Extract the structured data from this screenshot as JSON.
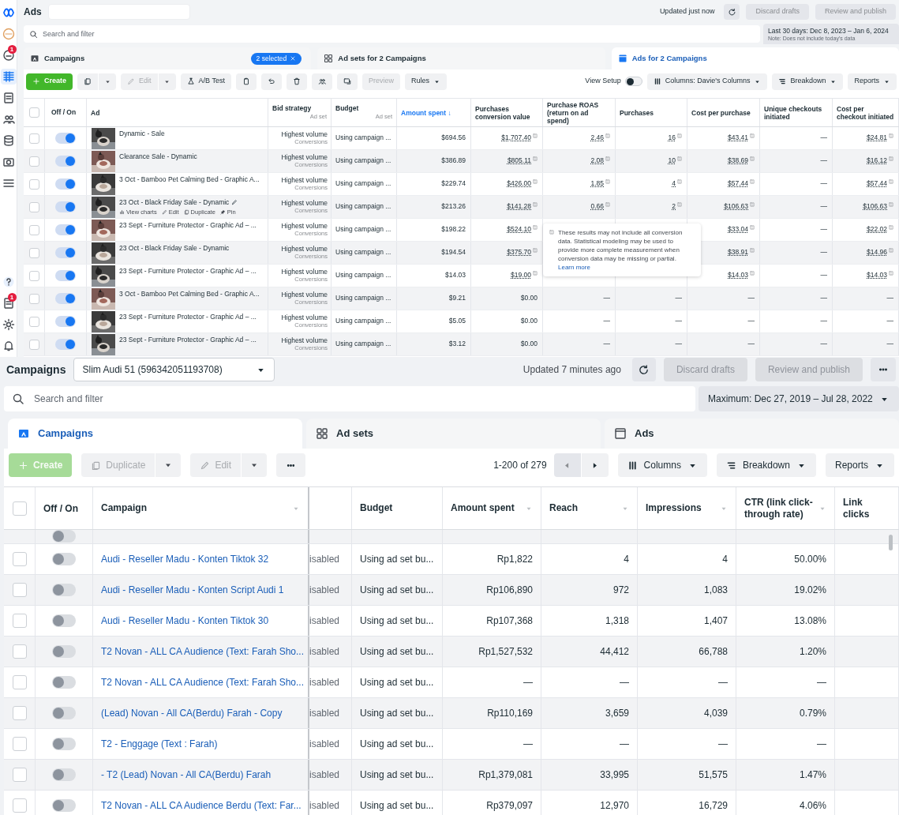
{
  "top": {
    "rail": {
      "top": [
        {
          "kind": "logo",
          "selected": false
        },
        {
          "kind": "avatar",
          "selected": false
        },
        {
          "kind": "alert",
          "selected": false,
          "badge": "1"
        },
        {
          "kind": "grid",
          "selected": true
        },
        {
          "kind": "doc",
          "selected": false
        },
        {
          "kind": "people",
          "selected": false
        },
        {
          "kind": "stack",
          "selected": false
        },
        {
          "kind": "camera",
          "selected": false
        },
        {
          "kind": "menu",
          "selected": false
        }
      ],
      "bottom": [
        {
          "kind": "help",
          "selected": false
        },
        {
          "kind": "doc",
          "selected": false,
          "badge": "1"
        },
        {
          "kind": "gear",
          "selected": false
        },
        {
          "kind": "bell",
          "selected": false
        }
      ]
    },
    "title": "Ads",
    "updated": "Updated just now",
    "actions": [
      {
        "label": "Discard drafts",
        "disabled": true
      },
      {
        "label": "Review and publish",
        "disabled": true
      }
    ],
    "search": {
      "placeholder": "Search and filter"
    },
    "date_range": {
      "label": "Last 30 days: Dec 8, 2023 – Jan 6, 2024",
      "note": "Note: Does not include today's data"
    },
    "tabs": [
      {
        "kind": "campaigns",
        "label": "Campaigns",
        "selected": false,
        "chip": "2 selected"
      },
      {
        "kind": "adsets",
        "label": "Ad sets for 2 Campaigns",
        "selected": false
      },
      {
        "kind": "ads",
        "label": "Ads for 2 Campaigns",
        "selected": true
      }
    ],
    "toolbar": [
      {
        "kind": "create",
        "label": "Create",
        "disabled": false
      },
      {
        "kind": "duplicate",
        "disabled": false
      },
      {
        "kind": "edit",
        "label": "Edit",
        "disabled": true
      },
      {
        "kind": "abtest",
        "label": "A/B Test",
        "disabled": false
      },
      {
        "kind": "clipboard",
        "disabled": false
      },
      {
        "kind": "undo",
        "disabled": false
      },
      {
        "kind": "delete",
        "disabled": false
      },
      {
        "kind": "audience",
        "disabled": false
      },
      {
        "kind": "export",
        "disabled": false
      },
      {
        "kind": "preview",
        "label": "Preview",
        "disabled": true
      },
      {
        "kind": "rules",
        "label": "Rules",
        "disabled": false
      }
    ],
    "view_setup": {
      "label": "View Setup",
      "on": false
    },
    "menus": [
      "Columns: Davie's Columns",
      "Breakdown",
      "Reports"
    ],
    "table": {
      "header_checked": false,
      "toggle_column": "Off / On",
      "columns": [
        {
          "kind": "ad",
          "label": "Ad",
          "sorted": false
        },
        {
          "kind": "bid",
          "label": "Bid strategy",
          "sub": "Ad set",
          "sorted": false
        },
        {
          "kind": "text",
          "label": "Budget",
          "sub": "Ad set",
          "sorted": false
        },
        {
          "kind": "metric",
          "label": "Amount spent ↓",
          "sorted": true
        },
        {
          "kind": "metric",
          "label": "Purchases conversion value",
          "sorted": false
        },
        {
          "kind": "metric",
          "label": "Purchase ROAS (return on ad spend)",
          "sorted": false
        },
        {
          "kind": "metric",
          "label": "Purchases",
          "sorted": false
        },
        {
          "kind": "metric",
          "label": "Cost per purchase",
          "sorted": false
        },
        {
          "kind": "metric",
          "label": "Unique checkouts initiated",
          "sorted": false
        },
        {
          "kind": "metric",
          "label": "Cost per checkout initiated",
          "sorted": false
        }
      ],
      "rows": [
        {
          "checked": false,
          "on": true,
          "cells": [
            {
              "text": "Dynamic - Sale"
            },
            {
              "text": "Highest volume",
              "sub": "Conversions"
            },
            "Using campaign ...",
            "$694.56",
            {
              "text": "$1,707.40",
              "modeled": true
            },
            {
              "text": "2.46",
              "modeled": true
            },
            {
              "text": "16",
              "modeled": true
            },
            {
              "text": "$43.41",
              "modeled": true
            },
            "—",
            {
              "text": "$24.81",
              "modeled": true
            }
          ]
        },
        {
          "checked": false,
          "on": true,
          "cells": [
            {
              "text": "Clearance Sale - Dynamic"
            },
            {
              "text": "Highest volume",
              "sub": "Conversions"
            },
            "Using campaign ...",
            "$386.89",
            {
              "text": "$805.11",
              "modeled": true
            },
            {
              "text": "2.08",
              "modeled": true
            },
            {
              "text": "10",
              "modeled": true
            },
            {
              "text": "$38.69",
              "modeled": true
            },
            "—",
            {
              "text": "$16.12",
              "modeled": true
            }
          ]
        },
        {
          "checked": false,
          "on": true,
          "cells": [
            {
              "text": "3 Oct - Bamboo Pet Calming Bed - Graphic A..."
            },
            {
              "text": "Highest volume",
              "sub": "Conversions"
            },
            "Using campaign ...",
            "$229.74",
            {
              "text": "$426.00",
              "modeled": true
            },
            {
              "text": "1.85",
              "modeled": true
            },
            {
              "text": "4",
              "modeled": true
            },
            {
              "text": "$57.44",
              "modeled": true
            },
            "—",
            {
              "text": "$57.44",
              "modeled": true
            }
          ]
        },
        {
          "checked": false,
          "on": true,
          "cells": [
            {
              "text": "23 Oct - Black Friday Sale - Dynamic",
              "actions": [
                "View charts",
                "Edit",
                "Duplicate",
                "Pin"
              ]
            },
            {
              "text": "Highest volume",
              "sub": "Conversions"
            },
            "Using campaign ...",
            "$213.26",
            {
              "text": "$141.28",
              "modeled": true
            },
            {
              "text": "0.66",
              "modeled": true
            },
            {
              "text": "2",
              "modeled": true
            },
            {
              "text": "$106.63",
              "modeled": true
            },
            "—",
            {
              "text": "$106.63",
              "modeled": true
            }
          ]
        },
        {
          "checked": false,
          "on": true,
          "cells": [
            {
              "text": "23 Sept - Furniture Protector - Graphic Ad – ..."
            },
            {
              "text": "Highest volume",
              "sub": "Conversions"
            },
            "Using campaign ...",
            "$198.22",
            {
              "text": "$524.10",
              "modeled": true
            },
            null,
            null,
            {
              "text": "$33.04",
              "modeled": true
            },
            "—",
            {
              "text": "$22.02",
              "modeled": true
            }
          ]
        },
        {
          "checked": false,
          "on": true,
          "cells": [
            {
              "text": "23 Oct - Black Friday Sale - Dynamic"
            },
            {
              "text": "Highest volume",
              "sub": "Conversions"
            },
            "Using campaign ...",
            "$194.54",
            {
              "text": "$375.70",
              "modeled": true
            },
            null,
            null,
            {
              "text": "$38.91",
              "modeled": true
            },
            "—",
            {
              "text": "$14.96",
              "modeled": true
            }
          ]
        },
        {
          "checked": false,
          "on": true,
          "cells": [
            {
              "text": "23 Sept - Furniture Protector - Graphic Ad – ..."
            },
            {
              "text": "Highest volume",
              "sub": "Conversions"
            },
            "Using campaign ...",
            "$14.03",
            {
              "text": "$19.00",
              "modeled": true
            },
            null,
            null,
            {
              "text": "$14.03",
              "modeled": true
            },
            "—",
            {
              "text": "$14.03",
              "modeled": true
            }
          ]
        },
        {
          "checked": false,
          "on": true,
          "cells": [
            {
              "text": "3 Oct - Bamboo Pet Calming Bed - Graphic A..."
            },
            {
              "text": "Highest volume",
              "sub": "Conversions"
            },
            "Using campaign ...",
            "$9.21",
            "$0.00",
            "—",
            "—",
            "—",
            "—",
            "—"
          ]
        },
        {
          "checked": false,
          "on": true,
          "cells": [
            {
              "text": "23 Sept - Furniture Protector - Graphic Ad – ..."
            },
            {
              "text": "Highest volume",
              "sub": "Conversions"
            },
            "Using campaign ...",
            "$5.05",
            "$0.00",
            "—",
            "—",
            "—",
            "—",
            "—"
          ]
        },
        {
          "checked": false,
          "on": true,
          "cells": [
            {
              "text": "23 Sept - Furniture Protector - Graphic Ad – ..."
            },
            {
              "text": "Highest volume",
              "sub": "Conversions"
            },
            "Using campaign ...",
            "$3.12",
            "$0.00",
            "—",
            "—",
            "—",
            "—",
            "—"
          ]
        }
      ]
    },
    "tooltip": {
      "text": "These results may not include all conversion data. Statistical modeling may be used to provide more complete measurement when conversion data may be missing or partial.",
      "link": "Learn more"
    }
  },
  "bottom": {
    "title": "Campaigns",
    "account": "Slim Audi 51 (596342051193708)",
    "updated": "Updated 7 minutes ago",
    "actions": [
      {
        "label": "Discard drafts",
        "disabled": true
      },
      {
        "label": "Review and publish",
        "disabled": true
      }
    ],
    "search": {
      "placeholder": "Search and filter"
    },
    "date_range": {
      "label": "Maximum: Dec 27, 2019 – Jul 28, 2022"
    },
    "tabs": [
      {
        "kind": "campaigns",
        "label": "Campaigns",
        "selected": true
      },
      {
        "kind": "adsets",
        "label": "Ad sets",
        "selected": false
      },
      {
        "kind": "ads",
        "label": "Ads",
        "selected": false
      }
    ],
    "toolbar": [
      {
        "kind": "create",
        "label": "Create",
        "disabled": true
      },
      {
        "kind": "duplicate",
        "label": "Duplicate",
        "disabled": true
      },
      {
        "kind": "edit",
        "label": "Edit",
        "disabled": true
      },
      {
        "kind": "more",
        "disabled": false
      }
    ],
    "pagination": "1-200 of 279",
    "menus": [
      "Columns",
      "Breakdown",
      "Reports"
    ],
    "table": {
      "header_checked": false,
      "toggle_column": "Off / On",
      "columns": [
        {
          "kind": "name",
          "label": "Campaign"
        },
        {
          "kind": "status"
        },
        {
          "kind": "text",
          "label": "Budget"
        },
        {
          "kind": "metric",
          "label": "Amount spent"
        },
        {
          "kind": "metric",
          "label": "Reach"
        },
        {
          "kind": "metric",
          "label": "Impressions"
        },
        {
          "kind": "metric",
          "label": "CTR (link click-through rate)"
        },
        {
          "kind": "metric",
          "label": "Link clicks"
        }
      ],
      "partial_row": {
        "on": false
      },
      "rows": [
        {
          "checked": false,
          "on": false,
          "cells": [
            "Audi - Reseller Madu - Konten Tiktok 32",
            "isabled",
            "Using ad set bu...",
            "Rp1,822",
            "4",
            "4",
            "50.00%"
          ]
        },
        {
          "checked": false,
          "on": false,
          "cells": [
            "Audi - Reseller Madu - Konten Script Audi 1",
            "isabled",
            "Using ad set bu...",
            "Rp106,890",
            "972",
            "1,083",
            "19.02%"
          ]
        },
        {
          "checked": false,
          "on": false,
          "cells": [
            "Audi - Reseller Madu - Konten Tiktok 30",
            "isabled",
            "Using ad set bu...",
            "Rp107,368",
            "1,318",
            "1,407",
            "13.08%"
          ]
        },
        {
          "checked": false,
          "on": false,
          "cells": [
            "T2 Novan - ALL CA Audience (Text: Farah Sho...",
            "isabled",
            "Using ad set bu...",
            "Rp1,527,532",
            "44,412",
            "66,788",
            "1.20%"
          ]
        },
        {
          "checked": false,
          "on": false,
          "cells": [
            "T2 Novan - ALL CA Audience (Text: Farah Sho...",
            "isabled",
            "Using ad set bu...",
            "—",
            "—",
            "—",
            "—"
          ]
        },
        {
          "checked": false,
          "on": false,
          "cells": [
            "(Lead) Novan - All CA(Berdu) Farah - Copy",
            "isabled",
            "Using ad set bu...",
            "Rp110,169",
            "3,659",
            "4,039",
            "0.79%"
          ]
        },
        {
          "checked": false,
          "on": false,
          "cells": [
            "T2 - Enggage (Text : Farah)",
            "isabled",
            "Using ad set bu...",
            "—",
            "—",
            "—",
            "—"
          ]
        },
        {
          "checked": false,
          "on": false,
          "cells": [
            "- T2 (Lead) Novan - All CA(Berdu) Farah",
            "isabled",
            "Using ad set bu...",
            "Rp1,379,081",
            "33,995",
            "51,575",
            "1.47%"
          ]
        },
        {
          "checked": false,
          "on": false,
          "cells": [
            "T2 Novan - ALL CA Audience Berdu (Text: Far...",
            "isabled",
            "Using ad set bu...",
            "Rp379,097",
            "12,970",
            "16,729",
            "4.06%"
          ]
        }
      ]
    }
  }
}
